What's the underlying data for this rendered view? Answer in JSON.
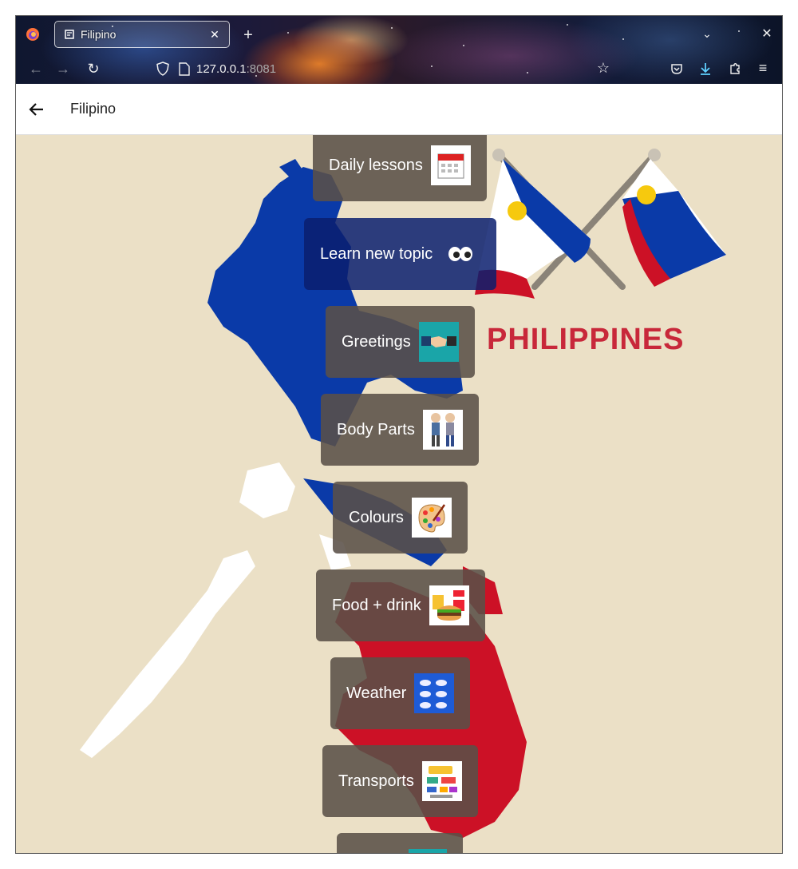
{
  "browser": {
    "tab_title": "Filipino",
    "url_host": "127.0.0.1",
    "url_port": ":8081"
  },
  "appbar": {
    "title": "Filipino"
  },
  "hero": {
    "country_label": "PHILIPPINES"
  },
  "menu": [
    {
      "label": "Daily lessons",
      "icon": "calendar-icon"
    },
    {
      "label": "Learn new topic",
      "icon": "eyes-icon"
    },
    {
      "label": "Greetings",
      "icon": "handshake-icon"
    },
    {
      "label": "Body Parts",
      "icon": "people-icon"
    },
    {
      "label": "Colours",
      "icon": "palette-icon"
    },
    {
      "label": "Food + drink",
      "icon": "food-icon"
    },
    {
      "label": "Weather",
      "icon": "weather-icon"
    },
    {
      "label": "Transports",
      "icon": "vehicles-icon"
    }
  ],
  "colors": {
    "background": "#ebe0c6",
    "button": "#5a5048",
    "flag_blue": "#0a3aa8",
    "flag_red": "#cc1126"
  }
}
